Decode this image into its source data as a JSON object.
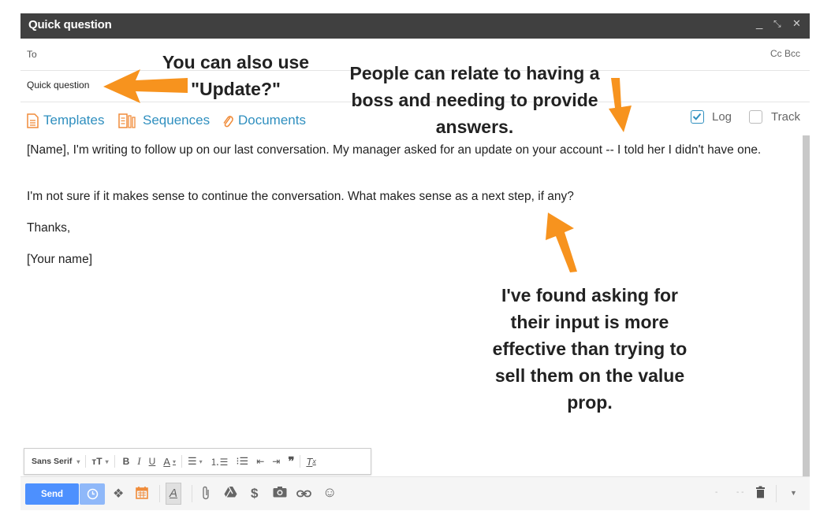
{
  "window": {
    "title": "Quick question",
    "controls": [
      "_",
      "⤡",
      "✕"
    ]
  },
  "recipients": {
    "to_label": "To",
    "cc_bcc_label": "Cc Bcc"
  },
  "subject": {
    "value": "Quick question"
  },
  "extensions": {
    "templates_label": "Templates",
    "sequences_label": "Sequences",
    "documents_label": "Documents",
    "log_label": "Log",
    "log_checked": true,
    "track_label": "Track",
    "track_checked": false,
    "accent_color": "#2f8fbf",
    "icon_color": "#f08c3a"
  },
  "message": {
    "paragraph_1": "[Name], I'm writing to follow up on our last conversation. My manager asked for an update on your account -- I told her I didn't have one.",
    "paragraph_2": "I'm not sure if it makes sense to continue the conversation. What makes sense as a next step, if any?",
    "paragraph_3": "Thanks,",
    "paragraph_4": "[Your name]"
  },
  "formatting": {
    "font_label": "Sans Serif"
  },
  "bottom": {
    "send_label": "Send",
    "send_color": "#4d90fe"
  },
  "annotations": {
    "update_note_line1": "You can also use",
    "update_note_line2": "\"Update?\"",
    "boss_note_line1": "People can relate to having a",
    "boss_note_line2": "boss and needing to provide",
    "boss_note_line3": "answers.",
    "input_note_line1": "I've found asking for",
    "input_note_line2": "their input is more",
    "input_note_line3": "effective than trying to",
    "input_note_line4": "sell them on the value",
    "input_note_line5": "prop.",
    "arrow_color": "#f7931e"
  }
}
